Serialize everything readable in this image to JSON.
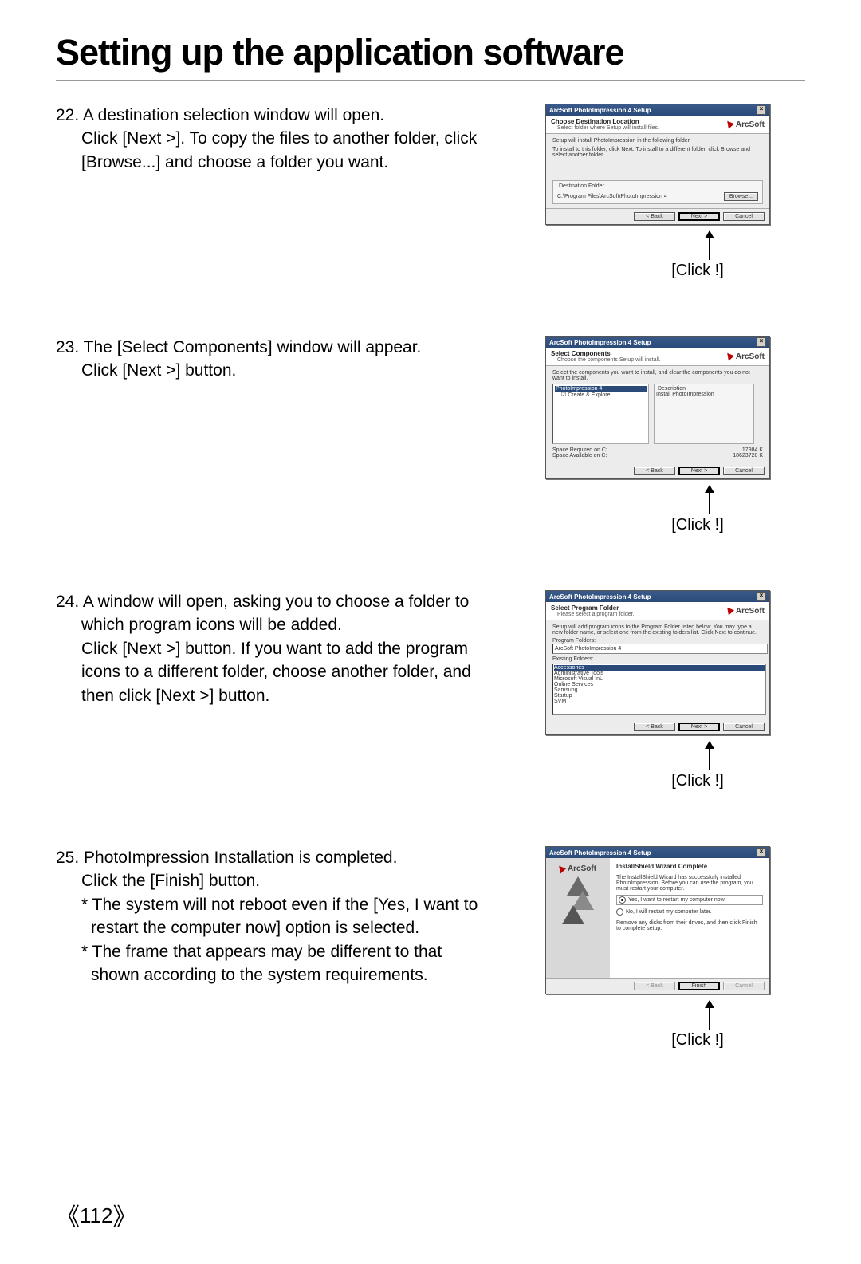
{
  "title": "Setting up the application software",
  "page_number": "112",
  "click_label": "[Click !]",
  "brand": "ArcSoft",
  "steps": [
    {
      "num": "22.",
      "text": "A destination selection window will open.",
      "lines": [
        "Click [Next >]. To copy the files to another folder, click",
        "[Browse...] and choose a folder you want."
      ],
      "dialog": {
        "title": "ArcSoft PhotoImpression 4 Setup",
        "header": "Choose Destination Location",
        "sub": "Select folder where Setup will install files.",
        "body1": "Setup will install PhotoImpression in the following folder.",
        "body2": "To install to this folder, click Next. To install to a different folder, click Browse and select another folder.",
        "dest_label": "Destination Folder",
        "dest_path": "C:\\Program Files\\ArcSoft\\PhotoImpression 4",
        "browse": "Browse...",
        "buttons": {
          "back": "< Back",
          "next": "Next >",
          "cancel": "Cancel"
        }
      }
    },
    {
      "num": "23.",
      "text": "The [Select Components] window will appear.",
      "lines": [
        "Click [Next >] button."
      ],
      "dialog": {
        "title": "ArcSoft PhotoImpression 4 Setup",
        "header": "Select Components",
        "sub": "Choose the components Setup will install.",
        "body1": "Select the components you want to install, and clear the components you do not want to install.",
        "tree": [
          "PhotoImpression 4",
          "☑ Create & Explore"
        ],
        "desc_label": "Description",
        "desc_text": "Install PhotoImpression",
        "space1": "Space Required on C:",
        "space1v": "17984 K",
        "space2": "Space Available on C:",
        "space2v": "18623728 K",
        "buttons": {
          "back": "< Back",
          "next": "Next >",
          "cancel": "Cancel"
        }
      }
    },
    {
      "num": "24.",
      "text": "A window will open, asking you to choose a folder to",
      "lines": [
        "which program icons will be added.",
        "Click [Next >] button. If you want to add the program",
        "icons to a different folder, choose another folder, and",
        "then click [Next >] button."
      ],
      "dialog": {
        "title": "ArcSoft PhotoImpression 4 Setup",
        "header": "Select Program Folder",
        "sub": "Please select a program folder.",
        "body1": "Setup will add program icons to the Program Folder listed below. You may type a new folder name, or select one from the existing folders list. Click Next to continue.",
        "pf_label": "Program Folders:",
        "pf_value": "ArcSoft PhotoImpression 4",
        "ef_label": "Existing Folders:",
        "ef_items": [
          "Accessories",
          "Administrative Tools",
          "Microsoft Visual InL",
          "Online Services",
          "Samsung",
          "Startup",
          "SVM"
        ],
        "buttons": {
          "back": "< Back",
          "next": "Next >",
          "cancel": "Cancel"
        }
      }
    },
    {
      "num": "25.",
      "text": "PhotoImpression Installation is completed.",
      "lines": [
        "Click the [Finish] button."
      ],
      "notes": [
        "* The system will not reboot even if the [Yes, I want to",
        "restart the computer now] option is selected.",
        "* The frame that appears may be different to that",
        "shown according to the system requirements."
      ],
      "dialog": {
        "title": "ArcSoft PhotoImpression 4 Setup",
        "header": "InstallShield Wizard Complete",
        "body1": "The InstallShield Wizard has successfully installed PhotoImpression. Before you can use the program, you must restart your computer.",
        "opt1": "Yes, I want to restart my computer now.",
        "opt2": "No, I will restart my computer later.",
        "body2": "Remove any disks from their drives, and then click Finish to complete setup.",
        "buttons": {
          "back": "< Back",
          "finish": "Finish",
          "cancel": "Cancel"
        }
      }
    }
  ]
}
